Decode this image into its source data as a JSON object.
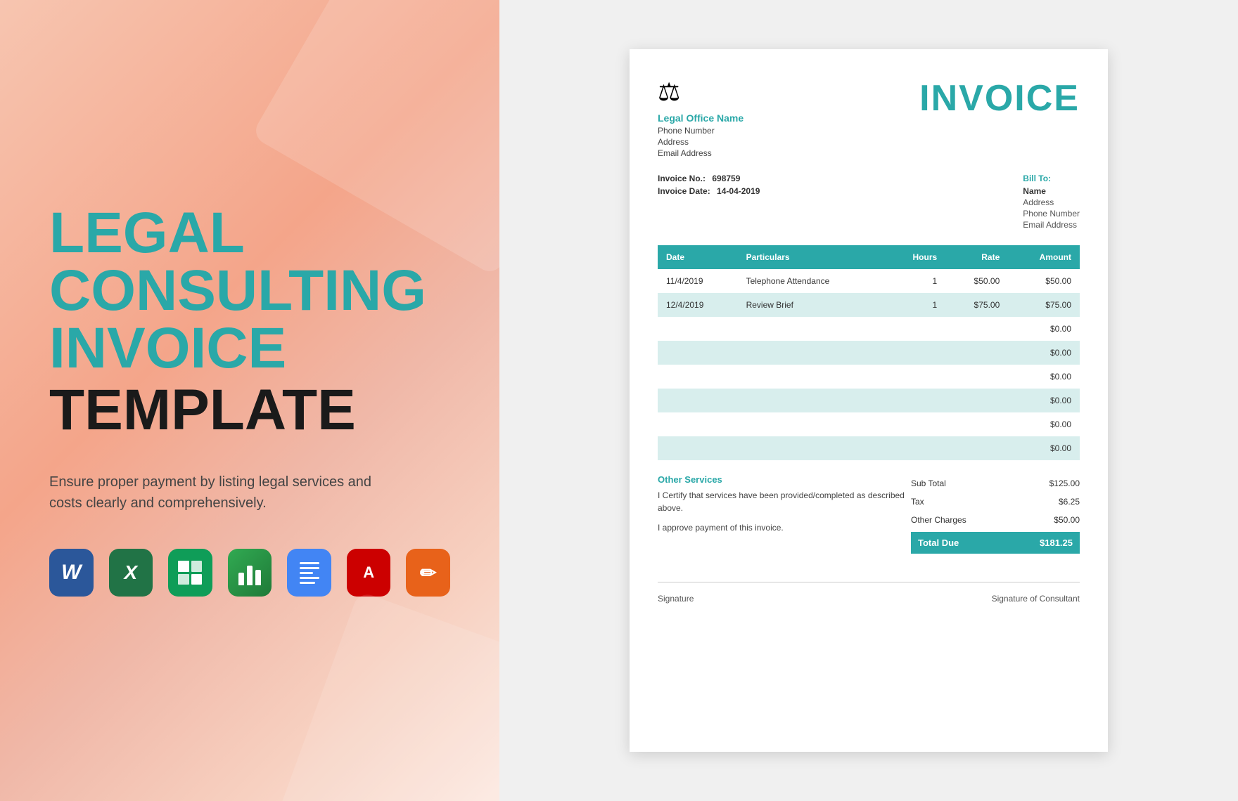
{
  "left": {
    "title_line1": "LEGAL",
    "title_line2": "CONSULTING",
    "title_line3": "INVOICE",
    "title_line4": "TEMPLATE",
    "description": "Ensure proper payment by listing legal services and costs clearly and comprehensively.",
    "icons": [
      {
        "name": "Microsoft Word",
        "type": "word"
      },
      {
        "name": "Microsoft Excel",
        "type": "excel"
      },
      {
        "name": "Google Sheets",
        "type": "gsheets"
      },
      {
        "name": "Numbers",
        "type": "numbers"
      },
      {
        "name": "Google Docs",
        "type": "gdocs"
      },
      {
        "name": "Adobe Acrobat",
        "type": "acrobat"
      },
      {
        "name": "Pages",
        "type": "pages"
      }
    ]
  },
  "invoice": {
    "title": "INVOICE",
    "company": {
      "name": "Legal Office Name",
      "phone": "Phone Number",
      "address": "Address",
      "email": "Email Address"
    },
    "invoice_no_label": "Invoice No.:",
    "invoice_no_value": "698759",
    "invoice_date_label": "Invoice Date:",
    "invoice_date_value": "14-04-2019",
    "bill_to_label": "Bill To:",
    "bill_to": {
      "name": "Name",
      "address": "Address",
      "phone": "Phone Number",
      "email": "Email Address"
    },
    "table": {
      "headers": [
        "Date",
        "Particulars",
        "Hours",
        "Rate",
        "Amount"
      ],
      "rows": [
        {
          "date": "11/4/2019",
          "particulars": "Telephone Attendance",
          "hours": "1",
          "rate": "$50.00",
          "amount": "$50.00"
        },
        {
          "date": "12/4/2019",
          "particulars": "Review Brief",
          "hours": "1",
          "rate": "$75.00",
          "amount": "$75.00"
        },
        {
          "date": "",
          "particulars": "",
          "hours": "",
          "rate": "",
          "amount": "$0.00"
        },
        {
          "date": "",
          "particulars": "",
          "hours": "",
          "rate": "",
          "amount": "$0.00"
        },
        {
          "date": "",
          "particulars": "",
          "hours": "",
          "rate": "",
          "amount": "$0.00"
        },
        {
          "date": "",
          "particulars": "",
          "hours": "",
          "rate": "",
          "amount": "$0.00"
        },
        {
          "date": "",
          "particulars": "",
          "hours": "",
          "rate": "",
          "amount": "$0.00"
        },
        {
          "date": "",
          "particulars": "",
          "hours": "",
          "rate": "",
          "amount": "$0.00"
        }
      ]
    },
    "other_services_label": "Other Services",
    "other_services_text": "I Certify that services have been provided/completed as described above.",
    "approve_text": "I approve payment of this invoice.",
    "subtotal_label": "Sub Total",
    "subtotal_value": "$125.00",
    "tax_label": "Tax",
    "tax_value": "$6.25",
    "other_charges_label": "Other Charges",
    "other_charges_value": "$50.00",
    "total_due_label": "Total Due",
    "total_due_value": "$181.25",
    "signature_left": "Signature",
    "signature_right": "Signature of Consultant"
  }
}
